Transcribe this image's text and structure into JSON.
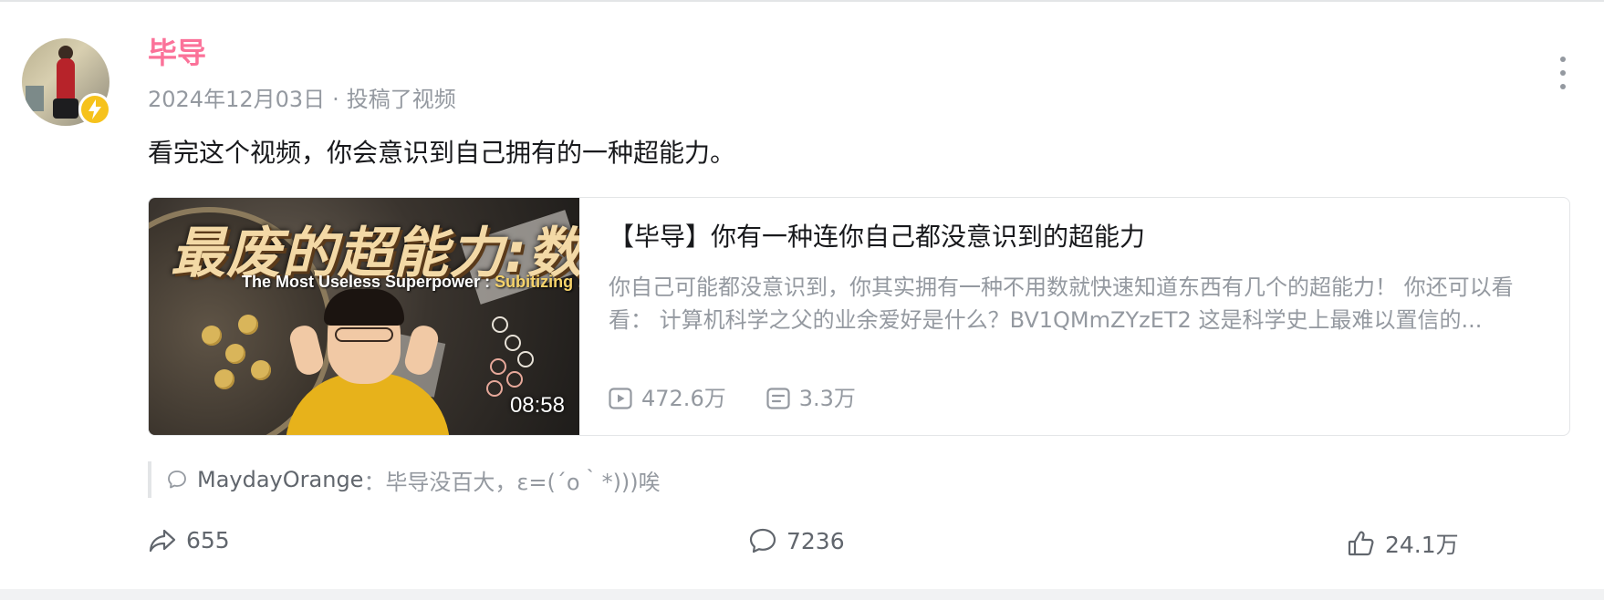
{
  "post": {
    "author": "毕导",
    "date": "2024年12月03日",
    "dot": "·",
    "action": "投稿了视频",
    "text": "看完这个视频，你会意识到自己拥有的一种超能力。"
  },
  "video": {
    "thumb_title": "最废的超能力:数觉!",
    "thumb_subtitle_prefix": "The Most Useless Superpower : ",
    "thumb_subtitle_emph": "Subitizing !",
    "duration": "08:58",
    "title": "【毕导】你有一种连你自己都没意识到的超能力",
    "description": "你自己可能都没意识到，你其实拥有一种不用数就快速知道东西有几个的超能力！ 你还可以看看： 计算机科学之父的业余爱好是什么？BV1QMmZYzET2 这是科学史上最难以置信的...",
    "plays": "472.6万",
    "danmaku": "3.3万"
  },
  "top_comment": {
    "user": "MaydayOrange",
    "separator": "：",
    "text": "毕导没百大，ε=(´ο｀*)))唉"
  },
  "actions": {
    "share": "655",
    "comment": "7236",
    "like": "24.1万"
  },
  "icons": {
    "more": "more-vertical-icon",
    "badge": "lightning-icon",
    "play": "play-icon",
    "danmaku": "danmaku-icon",
    "comment": "comment-bubble-icon",
    "share": "share-arrow-icon",
    "like": "thumbs-up-icon"
  },
  "colors": {
    "author": "#fb7299",
    "muted": "#9499a0",
    "badge": "#f6c21c"
  }
}
